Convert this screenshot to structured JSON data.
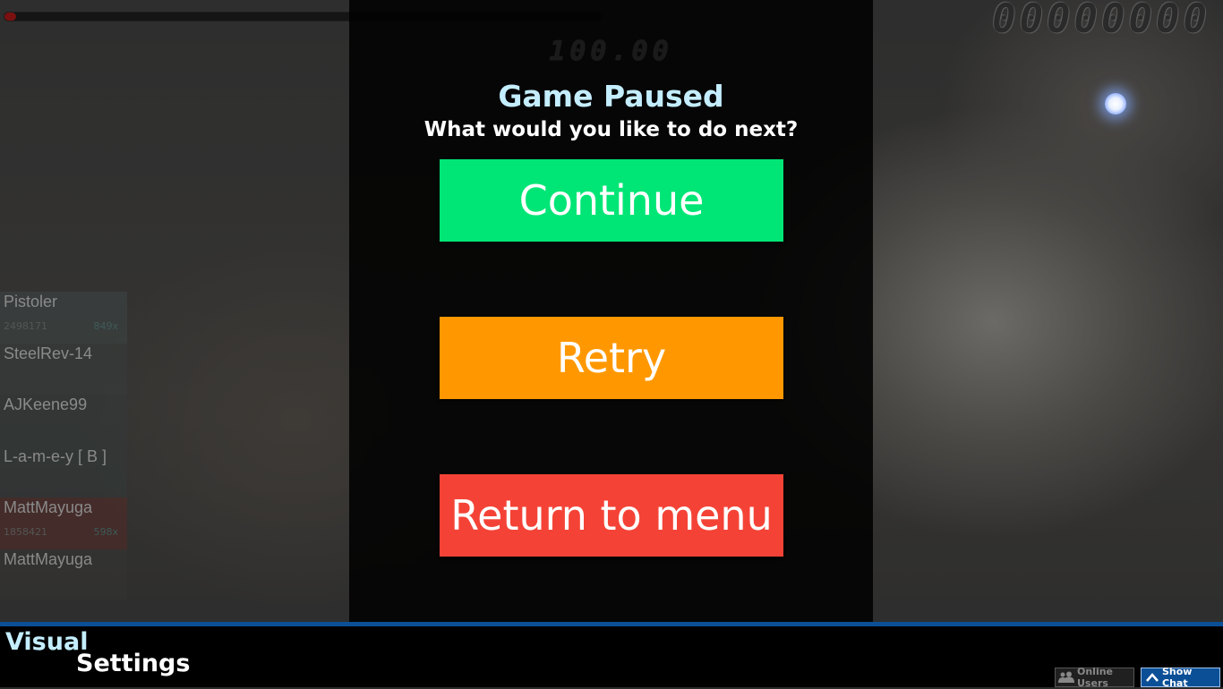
{
  "hud": {
    "score": "00000000",
    "combo": "100.00",
    "progress": 0.02,
    "progress_color": "#7a1010"
  },
  "leaderboard": [
    {
      "name": "Pistoler",
      "score": "2498171",
      "accuracy": "849x"
    },
    {
      "name": "SteelRev-14",
      "score": "",
      "accuracy": ""
    },
    {
      "name": "AJKeene99",
      "score": "",
      "accuracy": ""
    },
    {
      "name": "L-a-m-e-y [ B ]",
      "score": "",
      "accuracy": ""
    },
    {
      "name": "MattMayuga",
      "score": "1858421",
      "accuracy": "598x"
    },
    {
      "name": "MattMayuga",
      "score": "",
      "accuracy": ""
    }
  ],
  "pause": {
    "title": "Game Paused",
    "subtitle": "What would you like to do next?",
    "buttons": {
      "continue": {
        "label": "Continue",
        "color": "#00e676"
      },
      "retry": {
        "label": "Retry",
        "color": "#ff9800"
      },
      "menu": {
        "label": "Return to menu",
        "color": "#f44336"
      }
    }
  },
  "bottom": {
    "visual": "Visual",
    "settings": "Settings",
    "online_users": "Online Users",
    "show_chat": "Show Chat",
    "accent_color": "#0b4f96"
  },
  "icons": {
    "cursor": "cursor-glow-icon",
    "online_users": "users-icon",
    "show_chat": "chevron-up-icon"
  }
}
